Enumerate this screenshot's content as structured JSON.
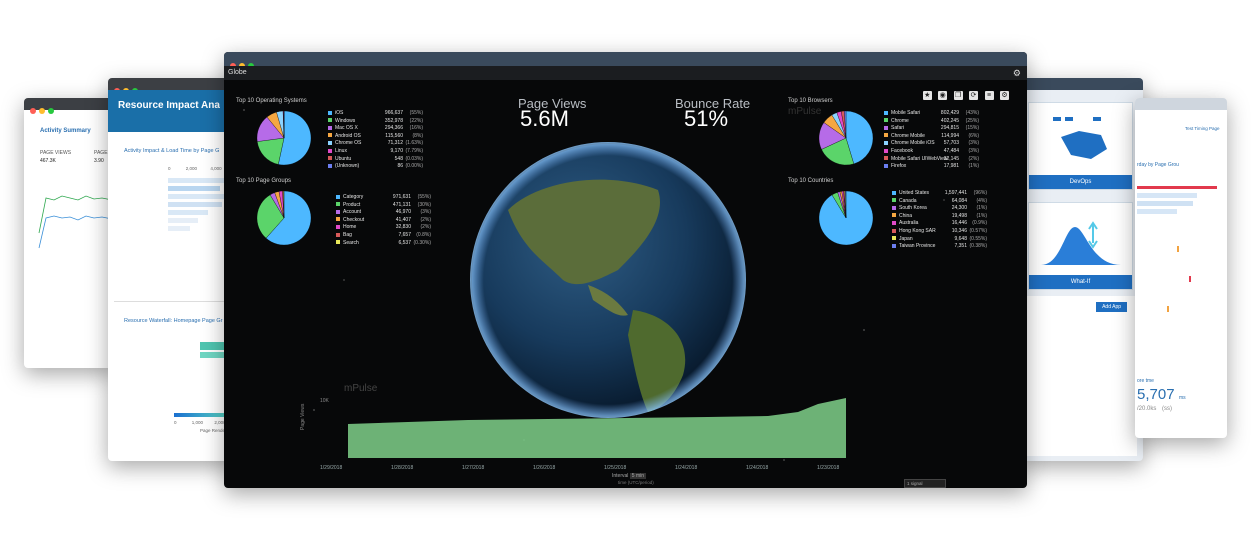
{
  "back_left_far": {
    "title": "Activity Summary",
    "kpi_label": "PAGE VIEWS",
    "kpi_value": "467.3K",
    "kpi2_label": "PAGE",
    "kpi2_value": "3.90"
  },
  "back_left_mid": {
    "header": "Resource Impact Ana",
    "chart1_title": "Activity Impact & Load Time by Page G",
    "chart2_title": "Resource Waterfall: Homepage Page Gr",
    "axis_ticks": [
      "0",
      "2,000",
      "4,000"
    ],
    "axis2_ticks": [
      "0",
      "1,000",
      "2,000"
    ],
    "axis2_label": "Page Render Ti"
  },
  "back_right_mid": {
    "card1_label": "DevOps",
    "card2_label": "What-If",
    "add_button": "Add App"
  },
  "back_right_far": {
    "link_text": "Test Timing Page",
    "kpi_value": "5,707",
    "kpi_unit": "ms",
    "kpi_sub": "/20.0ks",
    "kpi_sub2": "(ss)",
    "chart_title": "rday by Page Grou",
    "footer_label": "ore tme"
  },
  "main": {
    "tab_label": "Globe",
    "os_panel": {
      "title": "Top 10 Operating Systems",
      "rows": [
        {
          "name": "iOS",
          "value": "966,637",
          "pct": "(55%)",
          "color": "#4db8ff"
        },
        {
          "name": "Windows",
          "value": "352,978",
          "pct": "(22%)",
          "color": "#5bd46a"
        },
        {
          "name": "Mac OS X",
          "value": "294,366",
          "pct": "(16%)",
          "color": "#b66be8"
        },
        {
          "name": "Android OS",
          "value": "115,560",
          "pct": "(8%)",
          "color": "#f5a742"
        },
        {
          "name": "Chrome OS",
          "value": "71,312",
          "pct": "(1.63%)",
          "color": "#8bd3ff"
        },
        {
          "name": "Linux",
          "value": "9,170",
          "pct": "(7.79%)",
          "color": "#e14ac8"
        },
        {
          "name": "Ubuntu",
          "value": "548",
          "pct": "(0.03%)",
          "color": "#d85a5a"
        },
        {
          "name": "(Unknown)",
          "value": "86",
          "pct": "(0.00%)",
          "color": "#6c7ef0"
        }
      ]
    },
    "page_groups_panel": {
      "title": "Top 10 Page Groups",
      "rows": [
        {
          "name": "Category",
          "value": "971,631",
          "pct": "(55%)",
          "color": "#4db8ff"
        },
        {
          "name": "Product",
          "value": "471,131",
          "pct": "(30%)",
          "color": "#5bd46a"
        },
        {
          "name": "Account",
          "value": "46,970",
          "pct": "(3%)",
          "color": "#b66be8"
        },
        {
          "name": "Checkout",
          "value": "41,407",
          "pct": "(2%)",
          "color": "#f5a742"
        },
        {
          "name": "Home",
          "value": "32,830",
          "pct": "(2%)",
          "color": "#e14ac8"
        },
        {
          "name": "Bag",
          "value": "7,657",
          "pct": "(0.8%)",
          "color": "#d85a5a"
        },
        {
          "name": "Search",
          "value": "6,537",
          "pct": "(0.30%)",
          "color": "#e8e85a"
        }
      ]
    },
    "browsers_panel": {
      "title": "Top 10 Browsers",
      "watermark": "mPulse",
      "rows": [
        {
          "name": "Mobile Safari",
          "value": "802,429",
          "pct": "(43%)",
          "color": "#4db8ff"
        },
        {
          "name": "Chrome",
          "value": "402,245",
          "pct": "(25%)",
          "color": "#5bd46a"
        },
        {
          "name": "Safari",
          "value": "294,815",
          "pct": "(15%)",
          "color": "#b66be8"
        },
        {
          "name": "Chrome Mobile",
          "value": "114,994",
          "pct": "(6%)",
          "color": "#f5a742"
        },
        {
          "name": "Chrome Mobile iOS",
          "value": "57,703",
          "pct": "(3%)",
          "color": "#8bd3ff"
        },
        {
          "name": "Facebook",
          "value": "47,484",
          "pct": "(3%)",
          "color": "#e14ac8"
        },
        {
          "name": "Mobile Safari UIWebView",
          "value": "32,145",
          "pct": "(2%)",
          "color": "#d85a5a"
        },
        {
          "name": "Firefox",
          "value": "17,981",
          "pct": "(1%)",
          "color": "#6c7ef0"
        }
      ]
    },
    "countries_panel": {
      "title": "Top 10 Countries",
      "rows": [
        {
          "name": "United States",
          "value": "1,597,441",
          "pct": "(96%)",
          "color": "#4db8ff"
        },
        {
          "name": "Canada",
          "value": "64,084",
          "pct": "(4%)",
          "color": "#5bd46a"
        },
        {
          "name": "South Korea",
          "value": "24,300",
          "pct": "(1%)",
          "color": "#b66be8"
        },
        {
          "name": "China",
          "value": "19,498",
          "pct": "(1%)",
          "color": "#f5a742"
        },
        {
          "name": "Australia",
          "value": "16,446",
          "pct": "(0.9%)",
          "color": "#e14ac8"
        },
        {
          "name": "Hong Kong SAR",
          "value": "10,346",
          "pct": "(0.57%)",
          "color": "#d85a5a"
        },
        {
          "name": "Japan",
          "value": "9,648",
          "pct": "(0.55%)",
          "color": "#e8e85a"
        },
        {
          "name": "Taiwan Province",
          "value": "7,351",
          "pct": "(0.38%)",
          "color": "#6c7ef0"
        }
      ]
    },
    "page_views": {
      "label": "Page Views",
      "value": "5.6M"
    },
    "bounce_rate": {
      "label": "Bounce Rate",
      "value": "51%"
    },
    "timeline": {
      "dates": [
        "1/29/2018",
        "1/28/2018",
        "1/27/2018",
        "1/26/2018",
        "1/25/2018",
        "1/24/2018",
        "1/24/2018",
        "1/23/2018"
      ],
      "watermark": "mPulse",
      "y_tick": "10K",
      "y_label": "Page Views",
      "interval_label": "Interval",
      "interval_value": "5 min",
      "sub_label": "time (UTC/period)",
      "select_value": "1 signal"
    },
    "toolbar_icons": [
      "star-icon",
      "record-icon",
      "copy-icon",
      "refresh-icon",
      "list-icon",
      "settings-icon"
    ]
  }
}
